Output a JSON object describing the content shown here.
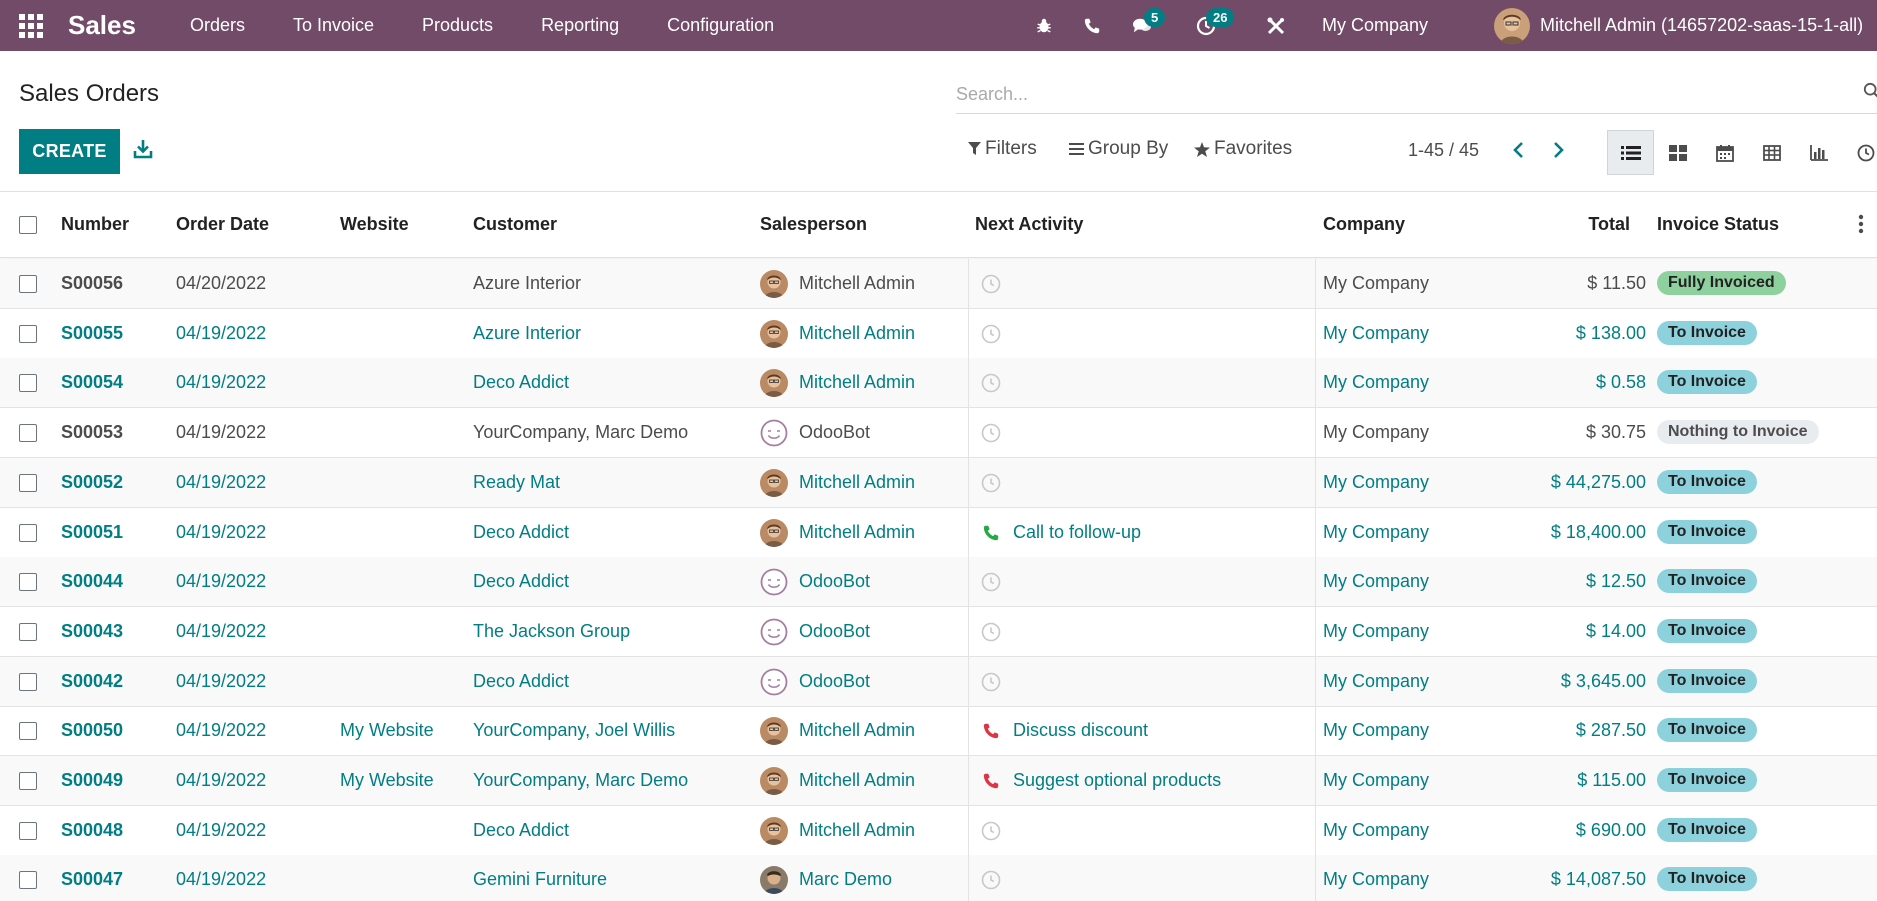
{
  "navbar": {
    "app_name": "Sales",
    "menu": [
      "Orders",
      "To Invoice",
      "Products",
      "Reporting",
      "Configuration"
    ],
    "messages_count": "5",
    "activities_count": "26",
    "company": "My Company",
    "user": "Mitchell Admin (14657202-saas-15-1-all)"
  },
  "control_panel": {
    "title": "Sales Orders",
    "search_placeholder": "Search...",
    "create_label": "CREATE",
    "filters_label": "Filters",
    "groupby_label": "Group By",
    "favorites_label": "Favorites",
    "pager": "1-45 / 45"
  },
  "columns": {
    "number": "Number",
    "order_date": "Order Date",
    "website": "Website",
    "customer": "Customer",
    "salesperson": "Salesperson",
    "next_activity": "Next Activity",
    "company": "Company",
    "total": "Total",
    "invoice_status": "Invoice Status"
  },
  "rows": [
    {
      "number": "S00056",
      "date": "04/20/2022",
      "website": "",
      "customer": "Azure Interior",
      "salesperson": "Mitchell Admin",
      "sp_type": "mitchell",
      "activity": "",
      "activity_type": "clock",
      "company": "My Company",
      "total": "$ 11.50",
      "status": "Fully Invoiced",
      "status_kind": "fully",
      "linked": false
    },
    {
      "number": "S00055",
      "date": "04/19/2022",
      "website": "",
      "customer": "Azure Interior",
      "salesperson": "Mitchell Admin",
      "sp_type": "mitchell",
      "activity": "",
      "activity_type": "clock",
      "company": "My Company",
      "total": "$ 138.00",
      "status": "To Invoice",
      "status_kind": "toinv",
      "linked": true
    },
    {
      "number": "S00054",
      "date": "04/19/2022",
      "website": "",
      "customer": "Deco Addict",
      "salesperson": "Mitchell Admin",
      "sp_type": "mitchell",
      "activity": "",
      "activity_type": "clock",
      "company": "My Company",
      "total": "$ 0.58",
      "status": "To Invoice",
      "status_kind": "toinv",
      "linked": true
    },
    {
      "number": "S00053",
      "date": "04/19/2022",
      "website": "",
      "customer": "YourCompany, Marc Demo",
      "salesperson": "OdooBot",
      "sp_type": "bot",
      "activity": "",
      "activity_type": "clock",
      "company": "My Company",
      "total": "$ 30.75",
      "status": "Nothing to Invoice",
      "status_kind": "nothing",
      "linked": false
    },
    {
      "number": "S00052",
      "date": "04/19/2022",
      "website": "",
      "customer": "Ready Mat",
      "salesperson": "Mitchell Admin",
      "sp_type": "mitchell",
      "activity": "",
      "activity_type": "clock",
      "company": "My Company",
      "total": "$ 44,275.00",
      "status": "To Invoice",
      "status_kind": "toinv",
      "linked": true
    },
    {
      "number": "S00051",
      "date": "04/19/2022",
      "website": "",
      "customer": "Deco Addict",
      "salesperson": "Mitchell Admin",
      "sp_type": "mitchell",
      "activity": "Call to follow-up",
      "activity_type": "phone-green",
      "company": "My Company",
      "total": "$ 18,400.00",
      "status": "To Invoice",
      "status_kind": "toinv",
      "linked": true
    },
    {
      "number": "S00044",
      "date": "04/19/2022",
      "website": "",
      "customer": "Deco Addict",
      "salesperson": "OdooBot",
      "sp_type": "bot",
      "activity": "",
      "activity_type": "clock",
      "company": "My Company",
      "total": "$ 12.50",
      "status": "To Invoice",
      "status_kind": "toinv",
      "linked": true
    },
    {
      "number": "S00043",
      "date": "04/19/2022",
      "website": "",
      "customer": "The Jackson Group",
      "salesperson": "OdooBot",
      "sp_type": "bot",
      "activity": "",
      "activity_type": "clock",
      "company": "My Company",
      "total": "$ 14.00",
      "status": "To Invoice",
      "status_kind": "toinv",
      "linked": true
    },
    {
      "number": "S00042",
      "date": "04/19/2022",
      "website": "",
      "customer": "Deco Addict",
      "salesperson": "OdooBot",
      "sp_type": "bot",
      "activity": "",
      "activity_type": "clock",
      "company": "My Company",
      "total": "$ 3,645.00",
      "status": "To Invoice",
      "status_kind": "toinv",
      "linked": true
    },
    {
      "number": "S00050",
      "date": "04/19/2022",
      "website": "My Website",
      "customer": "YourCompany, Joel Willis",
      "salesperson": "Mitchell Admin",
      "sp_type": "mitchell",
      "activity": "Discuss discount",
      "activity_type": "phone-red",
      "company": "My Company",
      "total": "$ 287.50",
      "status": "To Invoice",
      "status_kind": "toinv",
      "linked": true
    },
    {
      "number": "S00049",
      "date": "04/19/2022",
      "website": "My Website",
      "customer": "YourCompany, Marc Demo",
      "salesperson": "Mitchell Admin",
      "sp_type": "mitchell",
      "activity": "Suggest optional products",
      "activity_type": "phone-red",
      "company": "My Company",
      "total": "$ 115.00",
      "status": "To Invoice",
      "status_kind": "toinv",
      "linked": true
    },
    {
      "number": "S00048",
      "date": "04/19/2022",
      "website": "",
      "customer": "Deco Addict",
      "salesperson": "Mitchell Admin",
      "sp_type": "mitchell",
      "activity": "",
      "activity_type": "clock",
      "company": "My Company",
      "total": "$ 690.00",
      "status": "To Invoice",
      "status_kind": "toinv",
      "linked": true
    },
    {
      "number": "S00047",
      "date": "04/19/2022",
      "website": "",
      "customer": "Gemini Furniture",
      "salesperson": "Marc Demo",
      "sp_type": "marc",
      "activity": "",
      "activity_type": "clock",
      "company": "My Company",
      "total": "$ 14,087.50",
      "status": "To Invoice",
      "status_kind": "toinv",
      "linked": true
    }
  ],
  "colors": {
    "navbar": "#714b67",
    "primary": "#017e84",
    "badge_fully": "#8fd19e",
    "badge_toinvoice": "#8dd1dd",
    "badge_nothing": "#e9ecef",
    "activity_green": "#28a745",
    "activity_red": "#dc3545"
  }
}
